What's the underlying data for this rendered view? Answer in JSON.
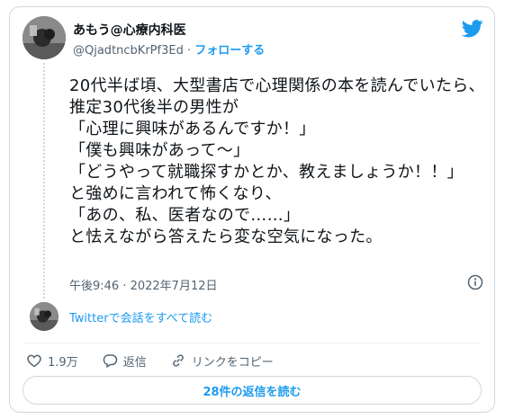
{
  "author": {
    "display_name": "あもう@心療内科医",
    "handle": "@QjadtncbKrPf3Ed",
    "separator": "·",
    "follow_label": "フォローする"
  },
  "tweet": {
    "text": "20代半ば頃、大型書店で心理関係の本を読んでいたら、推定30代後半の男性が\n「心理に興味があるんですか！」\n「僕も興味があって〜」\n「どうやって就職探すかとか、教えましょうか！！」\nと強めに言われて怖くなり、\n「あの、私、医者なので……」\nと怯えながら答えたら変な空気になった。",
    "timestamp": "午後9:46 · 2022年7月12日"
  },
  "thread": {
    "read_all_label": "Twitterで会話をすべて読む"
  },
  "actions": {
    "likes": "1.9万",
    "reply_label": "返信",
    "copy_link_label": "リンクをコピー"
  },
  "replies_button": "28件の返信を読む",
  "colors": {
    "accent": "#1d9bf0",
    "like": "#536471",
    "border": "#cfd9de"
  },
  "icons": [
    "twitter-bird-icon",
    "info-icon",
    "heart-icon",
    "reply-icon",
    "link-icon"
  ]
}
